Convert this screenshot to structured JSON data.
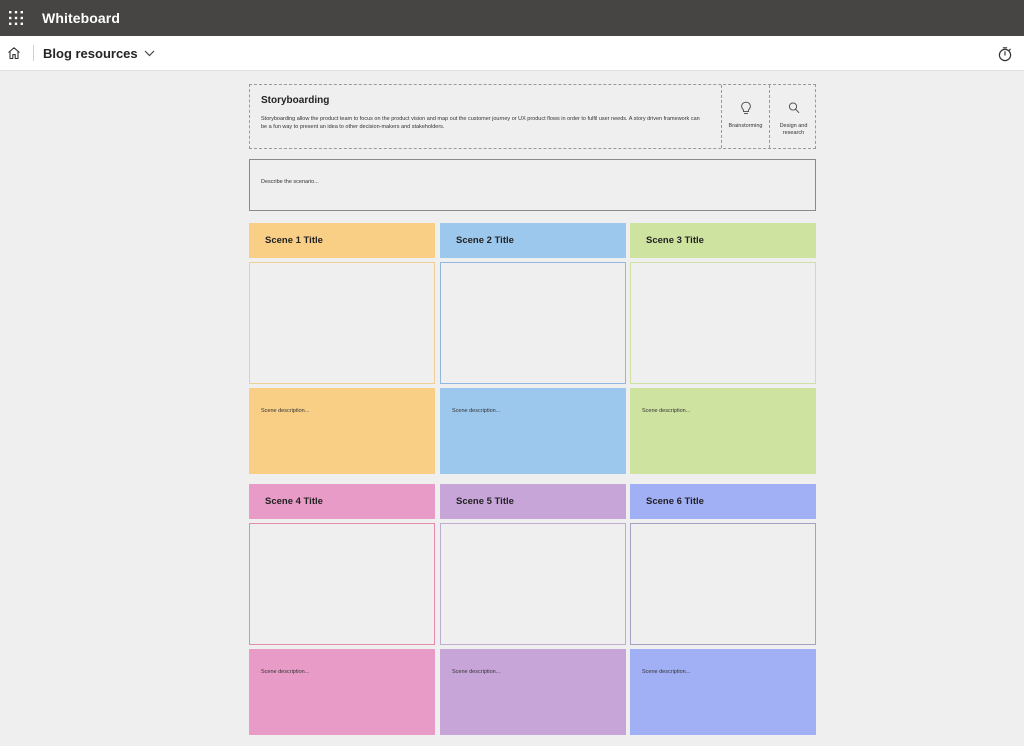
{
  "app": {
    "title": "Whiteboard",
    "icons": {
      "launcher": "app-launcher-icon",
      "home": "home-icon",
      "dropdown": "chevron-down-icon",
      "timer": "timer-icon"
    }
  },
  "board": {
    "name": "Blog resources"
  },
  "header": {
    "title": "Storyboarding",
    "description": "Storyboarding allow the product team to focus on the product vision and map out the customer journey or UX product flows in order to fulfil user needs. A story driven framework can be a fun way to present an idea to other decision-makers and stakeholders.",
    "tags": [
      {
        "label": "Brainstorming",
        "icon": "lightbulb-icon"
      },
      {
        "label": "Design and research",
        "icon": "search-icon"
      }
    ]
  },
  "scenario": {
    "placeholder": "Describe the scenario..."
  },
  "scenes": [
    {
      "title": "Scene 1 Title",
      "description": "Scene description...",
      "color": "#f9cf86",
      "border": "#f0cf96"
    },
    {
      "title": "Scene 2 Title",
      "description": "Scene description...",
      "color": "#9cc8ee",
      "border": "#8fb7e0"
    },
    {
      "title": "Scene 3 Title",
      "description": "Scene description...",
      "color": "#cfe3a0",
      "border": "#cfe0a5"
    },
    {
      "title": "Scene 4 Title",
      "description": "Scene description...",
      "color": "#e89bc7",
      "border": "#e58aa8"
    },
    {
      "title": "Scene 5 Title",
      "description": "Scene description...",
      "color": "#c7a5d9",
      "border": "#bdaed0"
    },
    {
      "title": "Scene 6 Title",
      "description": "Scene description...",
      "color": "#a1aff5",
      "border": "#a6a0c4"
    }
  ]
}
